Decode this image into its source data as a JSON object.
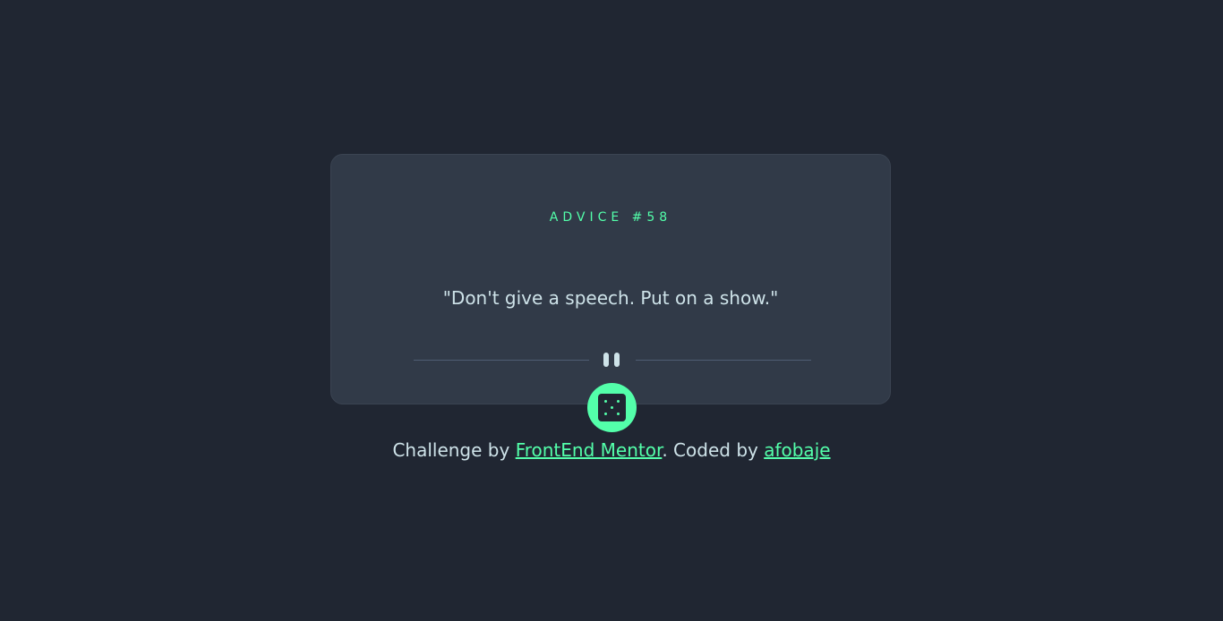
{
  "card": {
    "advice_id": "ADVICE #58",
    "advice_text": "\"Don't give a speech. Put on a show.\""
  },
  "dice_button": {
    "icon": "dice-icon"
  },
  "attribution": {
    "prefix": "Challenge by ",
    "challenge_link": "FrontEnd Mentor",
    "middle": ". Coded by ",
    "author_link": "afobaje"
  },
  "colors": {
    "background": "#202632",
    "card": "#313a48",
    "accent": "#53ffaa",
    "text": "#cee3e9",
    "divider": "#4f5d74"
  }
}
